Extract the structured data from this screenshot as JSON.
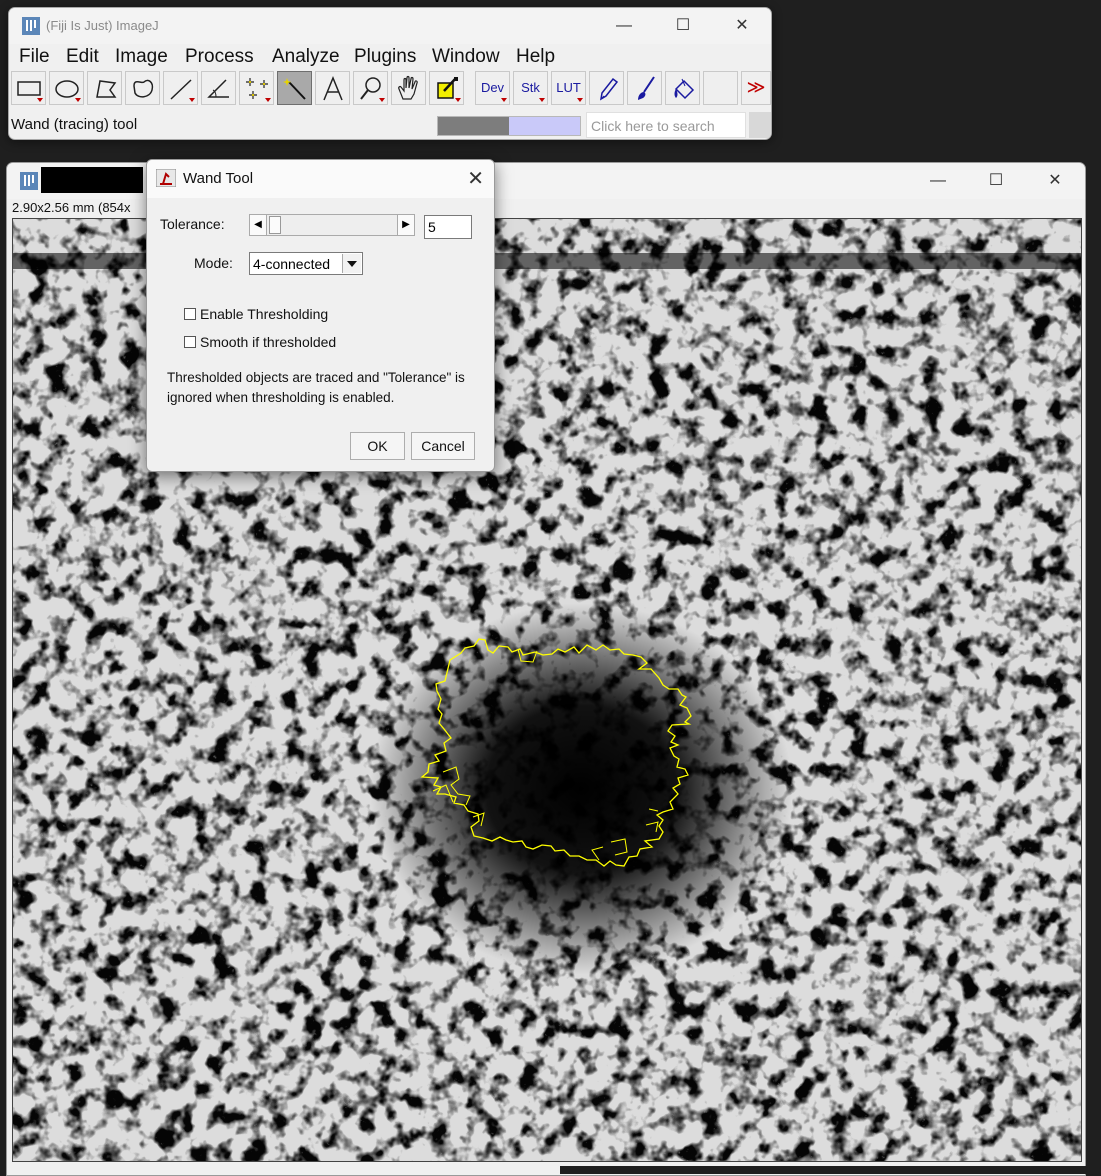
{
  "imagej": {
    "title": "(Fiji Is Just) ImageJ",
    "window_controls": {
      "minimize": "—",
      "maximize": "☐",
      "close": "✕"
    },
    "menus": [
      "File",
      "Edit",
      "Image",
      "Process",
      "Analyze",
      "Plugins",
      "Window",
      "Help"
    ],
    "tools": [
      {
        "name": "rectangle-tool",
        "icon": "rectangle-icon",
        "has_menu": true,
        "selected": false
      },
      {
        "name": "oval-tool",
        "icon": "oval-icon",
        "has_menu": true,
        "selected": false
      },
      {
        "name": "polygon-tool",
        "icon": "polygon-icon",
        "has_menu": false,
        "selected": false
      },
      {
        "name": "freehand-tool",
        "icon": "freehand-icon",
        "has_menu": false,
        "selected": false
      },
      {
        "name": "line-tool",
        "icon": "line-icon",
        "has_menu": true,
        "selected": false
      },
      {
        "name": "angle-tool",
        "icon": "angle-icon",
        "has_menu": false,
        "selected": false
      },
      {
        "name": "point-tool",
        "icon": "multipoint-icon",
        "has_menu": true,
        "selected": false
      },
      {
        "name": "wand-tool",
        "icon": "wand-icon",
        "has_menu": false,
        "selected": true
      },
      {
        "name": "text-tool",
        "icon": "text-icon",
        "has_menu": false,
        "selected": false
      },
      {
        "name": "magnifier-tool",
        "icon": "magnifier-icon",
        "has_menu": true,
        "selected": false
      },
      {
        "name": "scroll-tool",
        "icon": "hand-icon",
        "has_menu": false,
        "selected": false
      },
      {
        "name": "color-picker-tool",
        "icon": "color-picker-icon",
        "has_menu": true,
        "selected": false
      }
    ],
    "text_tools": [
      {
        "name": "dev-menu-tool",
        "label": "Dev"
      },
      {
        "name": "stk-menu-tool",
        "label": "Stk"
      },
      {
        "name": "lut-menu-tool",
        "label": "LUT"
      }
    ],
    "status": "Wand (tracing) tool",
    "progress_fraction": 0.5,
    "search_placeholder": "Click here to search",
    "more_tools": "≫"
  },
  "image_window": {
    "info": "2.90x2.56 mm (854x"
  },
  "wand_dialog": {
    "title": "Wand Tool",
    "close": "✕",
    "tolerance_label": "Tolerance:",
    "tolerance_value": "5",
    "slider_left": "◀",
    "slider_right": "▶",
    "mode_label": "Mode:",
    "mode_value": "4-connected",
    "enable_thresholding": "Enable Thresholding",
    "smooth_if_thresholded": "Smooth if thresholded",
    "note": "Thresholded objects are traced and \"Tolerance\" is ignored when thresholding is enabled.",
    "ok": "OK",
    "cancel": "Cancel"
  },
  "colors": {
    "selection": "#ffff00",
    "image_background": "#000000",
    "vessel": "#d8d8d8"
  }
}
